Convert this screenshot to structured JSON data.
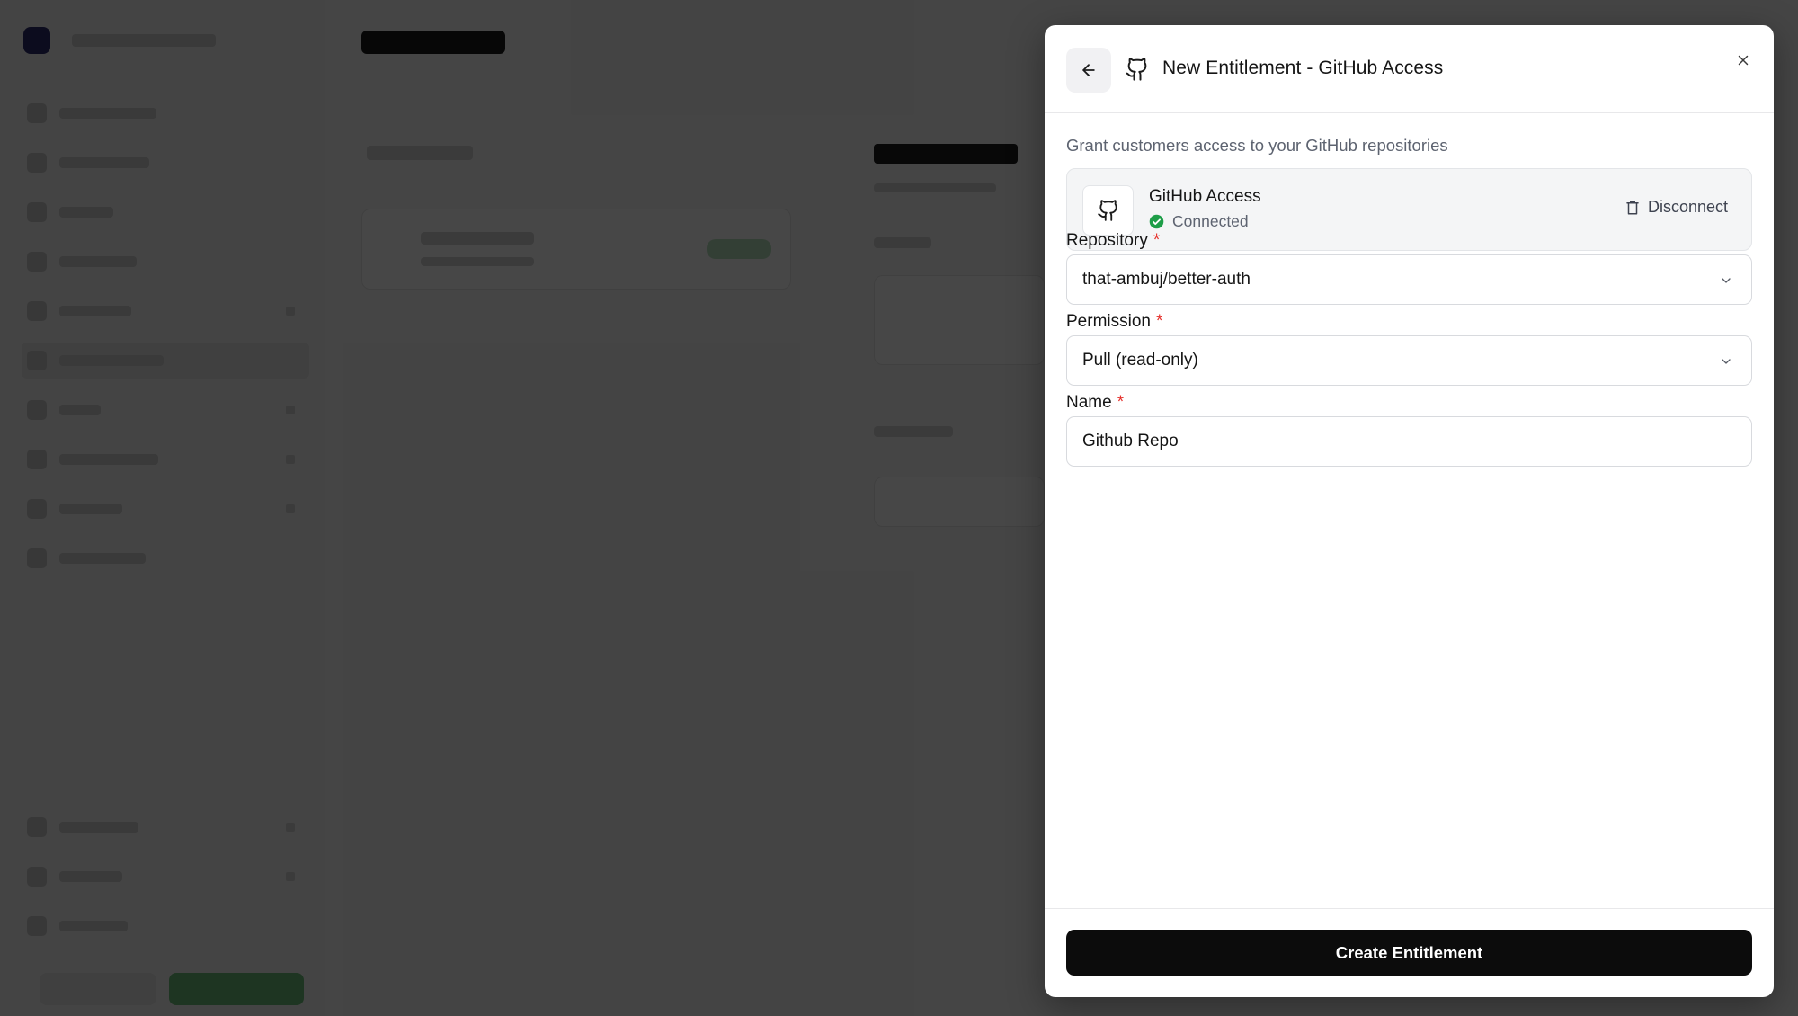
{
  "dialog": {
    "title": "New Entitlement - GitHub Access",
    "subtitle": "Grant customers access to your GitHub repositories",
    "connection": {
      "name": "GitHub Access",
      "status": "Connected",
      "status_color": "#1e9e48",
      "disconnect_label": "Disconnect"
    },
    "fields": {
      "repository": {
        "label": "Repository",
        "required_mark": "*",
        "value": "that-ambuj/better-auth"
      },
      "permission": {
        "label": "Permission",
        "required_mark": "*",
        "value": "Pull (read-only)"
      },
      "name": {
        "label": "Name",
        "required_mark": "*",
        "value": "Github Repo"
      }
    },
    "submit_label": "Create Entitlement",
    "icons": {
      "back": "arrow-left-icon",
      "header": "github-icon",
      "close": "close-icon",
      "connection": "github-icon",
      "status": "check-circle-icon",
      "disconnect": "trash-icon",
      "dropdown": "chevron-down-icon"
    }
  },
  "colors": {
    "primary_button": "#0c0c0c",
    "required": "#e5322d",
    "overlay": "rgba(0,0,0,0.72)"
  }
}
